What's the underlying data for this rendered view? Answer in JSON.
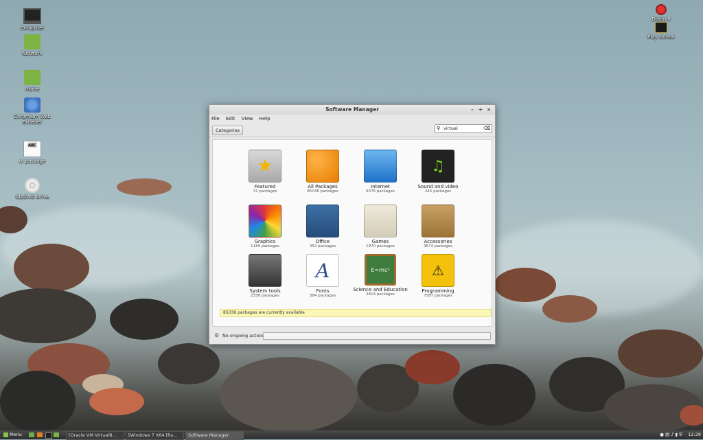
{
  "desktop": {
    "icons_left": [
      {
        "label": "Computer",
        "icon": "monitor-icon"
      },
      {
        "label": "Network",
        "icon": "folder-network-icon"
      },
      {
        "label": "Home",
        "icon": "folder-home-icon"
      },
      {
        "label": "Chromium Web Browser",
        "icon": "chromium-icon"
      },
      {
        "label": "tv package",
        "icon": "document-icon"
      },
      {
        "label": "CD/DVD Drive",
        "icon": "disc-icon"
      }
    ],
    "icons_right": [
      {
        "label": "Doom II",
        "icon": "doom-icon"
      },
      {
        "label": "Play Unreal",
        "icon": "unreal-icon"
      }
    ]
  },
  "window": {
    "title": "Software Manager",
    "controls": {
      "minimize": "–",
      "maximize": "+",
      "close": "×"
    },
    "menu": [
      "File",
      "Edit",
      "View",
      "Help"
    ],
    "categories_button": "Categories",
    "search": {
      "value": "virtual",
      "icon": "search-icon",
      "clear_icon": "clear-icon"
    },
    "categories": [
      {
        "name": "Featured",
        "count": "31 packages"
      },
      {
        "name": "All Packages",
        "count": "85036 packages"
      },
      {
        "name": "Internet",
        "count": "6376 packages"
      },
      {
        "name": "Sound and video",
        "count": "245 packages"
      },
      {
        "name": "Graphics",
        "count": "1189 packages"
      },
      {
        "name": "Office",
        "count": "352 packages"
      },
      {
        "name": "Games",
        "count": "1970 packages"
      },
      {
        "name": "Accessories",
        "count": "3674 packages"
      },
      {
        "name": "System tools",
        "count": "2358 packages"
      },
      {
        "name": "Fonts",
        "count": "384 packages"
      },
      {
        "name": "Science and Education",
        "count": "2814 packages"
      },
      {
        "name": "Programming",
        "count": "7587 packages"
      }
    ],
    "notice": "85036 packages are currently available",
    "status": "No ongoing actions",
    "sci_tile_text": "E=mc²",
    "fonts_tile_text": "A"
  },
  "panel": {
    "menu_label": "Menu",
    "tasks": [
      {
        "label": "[Oracle VM VirtualB..."
      },
      {
        "label": "[Windows 7 X64 [Ru..."
      },
      {
        "label": "Software Manager"
      }
    ],
    "clock": "12:29"
  }
}
